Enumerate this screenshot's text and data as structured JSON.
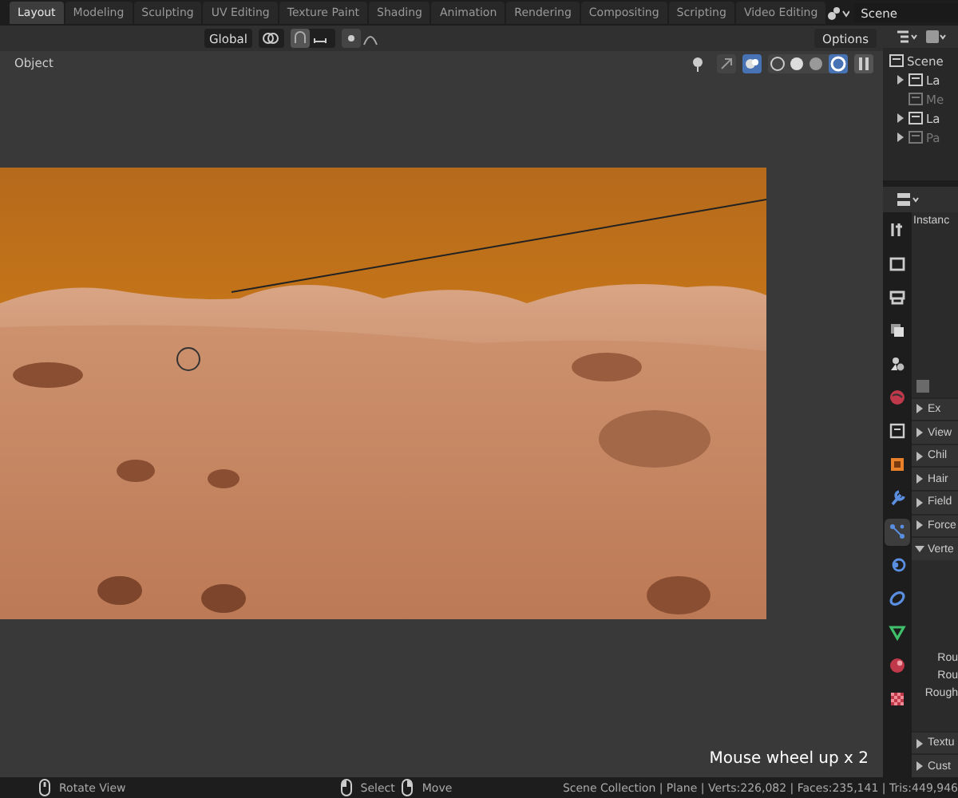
{
  "workspace_tabs": [
    {
      "label": "Layout",
      "selected": true
    },
    {
      "label": "Modeling",
      "selected": false
    },
    {
      "label": "Sculpting",
      "selected": false
    },
    {
      "label": "UV Editing",
      "selected": false
    },
    {
      "label": "Texture Paint",
      "selected": false
    },
    {
      "label": "Shading",
      "selected": false
    },
    {
      "label": "Animation",
      "selected": false
    },
    {
      "label": "Rendering",
      "selected": false
    },
    {
      "label": "Compositing",
      "selected": false
    },
    {
      "label": "Scripting",
      "selected": false
    },
    {
      "label": "Video Editing",
      "selected": false
    }
  ],
  "scene_field": {
    "value": "Scene"
  },
  "tool_header": {
    "orientation": "Global",
    "options_button": "Options"
  },
  "viewport": {
    "mode_label": "Object",
    "overlay_message": "Mouse wheel up x 2"
  },
  "outliner": {
    "items": [
      {
        "label": "Scene",
        "dimmed": false,
        "children": [
          {
            "label": "La",
            "dimmed": false,
            "expandable": true
          },
          {
            "label": "Me",
            "dimmed": true,
            "expandable": false
          },
          {
            "label": "La",
            "dimmed": false,
            "expandable": true
          },
          {
            "label": "Pa",
            "dimmed": true,
            "expandable": true
          }
        ]
      }
    ]
  },
  "properties": {
    "header_text": "Instanc",
    "tabs": [
      {
        "kind": "tool",
        "selected": false
      },
      {
        "kind": "render",
        "selected": false
      },
      {
        "kind": "output",
        "selected": false
      },
      {
        "kind": "view_layer",
        "selected": false
      },
      {
        "kind": "scene",
        "selected": false
      },
      {
        "kind": "world",
        "selected": false
      },
      {
        "kind": "collection",
        "selected": false
      },
      {
        "kind": "object",
        "selected": false
      },
      {
        "kind": "modifier",
        "selected": false
      },
      {
        "kind": "particles",
        "selected": true
      },
      {
        "kind": "physics",
        "selected": false
      },
      {
        "kind": "constraints",
        "selected": false
      },
      {
        "kind": "data",
        "selected": false
      },
      {
        "kind": "material",
        "selected": false
      },
      {
        "kind": "texture",
        "selected": false
      }
    ],
    "panels_top": [
      {
        "label": "Ex",
        "expanded": false
      },
      {
        "label": "View",
        "expanded": false
      },
      {
        "label": "Chil",
        "expanded": false
      },
      {
        "label": "Hair",
        "expanded": false
      },
      {
        "label": "Field",
        "expanded": false
      },
      {
        "label": "Force",
        "expanded": false
      },
      {
        "label": "Verte",
        "expanded": true
      }
    ],
    "field_labels": [
      "Rou",
      "Rou",
      "Rough"
    ],
    "panels_bottom": [
      {
        "label": "Textu",
        "expanded": false
      },
      {
        "label": "Cust",
        "expanded": false
      }
    ]
  },
  "status_bar": {
    "hints": [
      {
        "kind": "middle",
        "label": "Rotate View"
      },
      {
        "kind": "left",
        "label": "Select"
      },
      {
        "kind": "right",
        "label": "Move"
      }
    ],
    "stats": "Scene Collection | Plane | Verts:226,082 | Faces:235,141 | Tris:449,946"
  }
}
